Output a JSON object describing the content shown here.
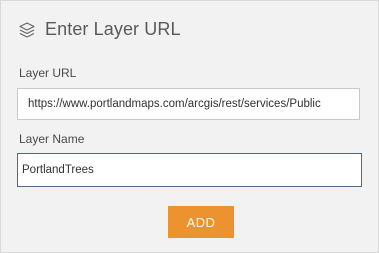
{
  "panel": {
    "title": "Enter Layer URL",
    "title_icon": "layers-icon"
  },
  "fields": {
    "layer_url": {
      "label": "Layer URL",
      "value": "https://www.portlandmaps.com/arcgis/rest/services/Public"
    },
    "layer_name": {
      "label": "Layer Name",
      "value": "PortlandTrees"
    }
  },
  "actions": {
    "add_label": "ADD"
  },
  "colors": {
    "accent": "#ec922f",
    "panel_bg": "#f2f2f2",
    "focus_border": "#4f6b8a"
  }
}
